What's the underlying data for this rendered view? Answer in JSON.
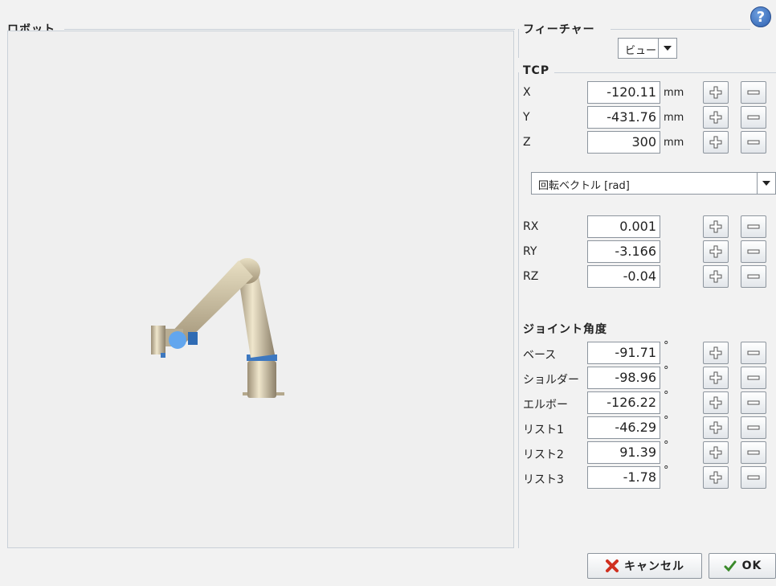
{
  "robot_panel": {
    "title": "ロボット"
  },
  "features_panel": {
    "title": "フィーチャー",
    "view_select": "ビュー"
  },
  "tcp": {
    "title": "TCP",
    "rows": [
      {
        "label": "X",
        "value": "-120.11",
        "unit": "mm"
      },
      {
        "label": "Y",
        "value": "-431.76",
        "unit": "mm"
      },
      {
        "label": "Z",
        "value": "300",
        "unit": "mm"
      }
    ],
    "rotation_select": "回転ベクトル [rad]",
    "rot_rows": [
      {
        "label": "RX",
        "value": "0.001"
      },
      {
        "label": "RY",
        "value": "-3.166"
      },
      {
        "label": "RZ",
        "value": "-0.04"
      }
    ]
  },
  "joints": {
    "title": "ジョイント角度",
    "unit": "°",
    "rows": [
      {
        "label": "ベース",
        "value": "-91.71"
      },
      {
        "label": "ショルダー",
        "value": "-98.96"
      },
      {
        "label": "エルボー",
        "value": "-126.22"
      },
      {
        "label": "リスト1",
        "value": "-46.29"
      },
      {
        "label": "リスト2",
        "value": "91.39"
      },
      {
        "label": "リスト3",
        "value": "-1.78"
      }
    ]
  },
  "buttons": {
    "cancel": "キャンセル",
    "ok": "OK",
    "help": "?"
  }
}
